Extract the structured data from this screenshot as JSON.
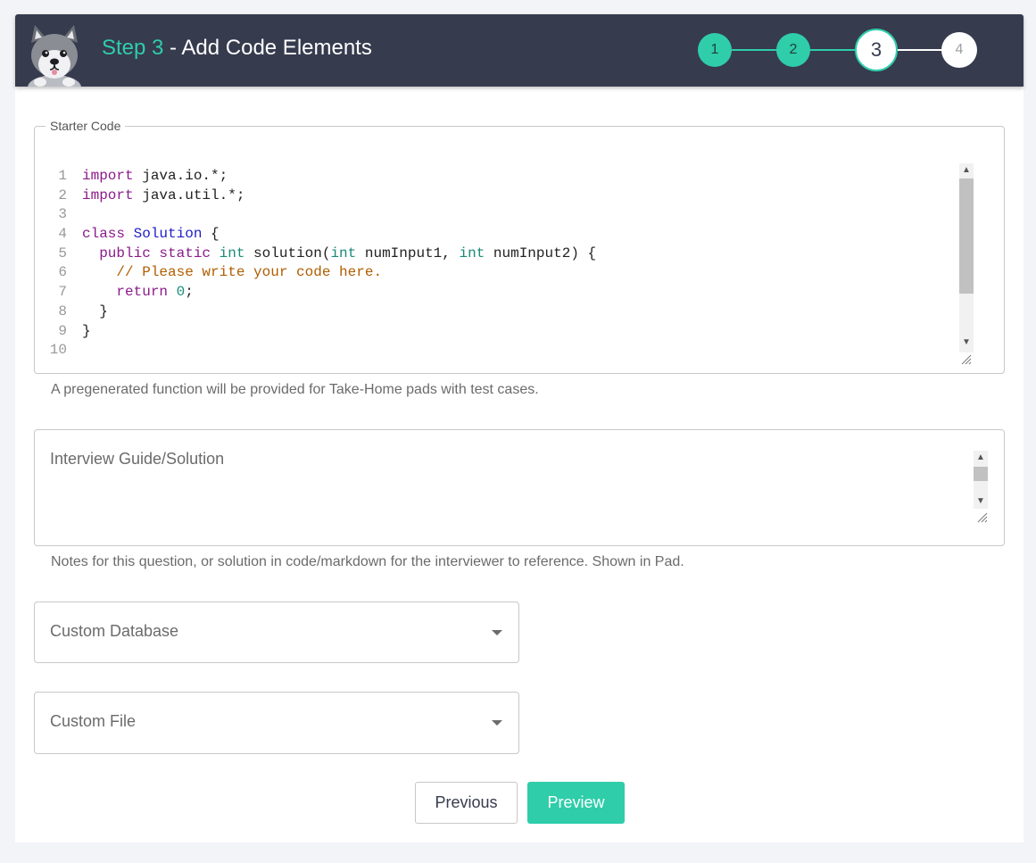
{
  "header": {
    "step_label": "Step 3",
    "title_rest": " - Add Code Elements",
    "steps": [
      {
        "label": "1",
        "state": "done"
      },
      {
        "label": "2",
        "state": "done"
      },
      {
        "label": "3",
        "state": "current"
      },
      {
        "label": "4",
        "state": "future"
      }
    ]
  },
  "starter_code": {
    "legend": "Starter Code",
    "line_numbers": [
      "1",
      "2",
      "3",
      "4",
      "5",
      "6",
      "7",
      "8",
      "9",
      "10"
    ],
    "lines": [
      [
        {
          "t": "import",
          "c": "kw"
        },
        {
          "t": " java.io.*;",
          "c": "plain"
        }
      ],
      [
        {
          "t": "import",
          "c": "kw"
        },
        {
          "t": " java.util.*;",
          "c": "plain"
        }
      ],
      [],
      [
        {
          "t": "class ",
          "c": "kw"
        },
        {
          "t": "Solution",
          "c": "cls"
        },
        {
          "t": " {",
          "c": "plain"
        }
      ],
      [
        {
          "t": "  public static ",
          "c": "kw"
        },
        {
          "t": "int",
          "c": "typ"
        },
        {
          "t": " solution(",
          "c": "plain"
        },
        {
          "t": "int",
          "c": "typ"
        },
        {
          "t": " numInput1, ",
          "c": "plain"
        },
        {
          "t": "int",
          "c": "typ"
        },
        {
          "t": " numInput2) {",
          "c": "plain"
        }
      ],
      [
        {
          "t": "    // Please write your code here.",
          "c": "cmt"
        }
      ],
      [
        {
          "t": "    return ",
          "c": "kw"
        },
        {
          "t": "0",
          "c": "num"
        },
        {
          "t": ";",
          "c": "plain"
        }
      ],
      [
        {
          "t": "  }",
          "c": "plain"
        }
      ],
      [
        {
          "t": "}",
          "c": "plain"
        }
      ],
      []
    ],
    "help": "A pregenerated function will be provided for Take-Home pads with test cases."
  },
  "interview_guide": {
    "placeholder": "Interview Guide/Solution",
    "help": "Notes for this question, or solution in code/markdown for the interviewer to reference. Shown in Pad."
  },
  "custom_database": {
    "label": "Custom Database"
  },
  "custom_file": {
    "label": "Custom File"
  },
  "buttons": {
    "previous": "Previous",
    "preview": "Preview"
  },
  "colors": {
    "accent": "#2fcdaa",
    "header_bg": "#363b4e"
  }
}
